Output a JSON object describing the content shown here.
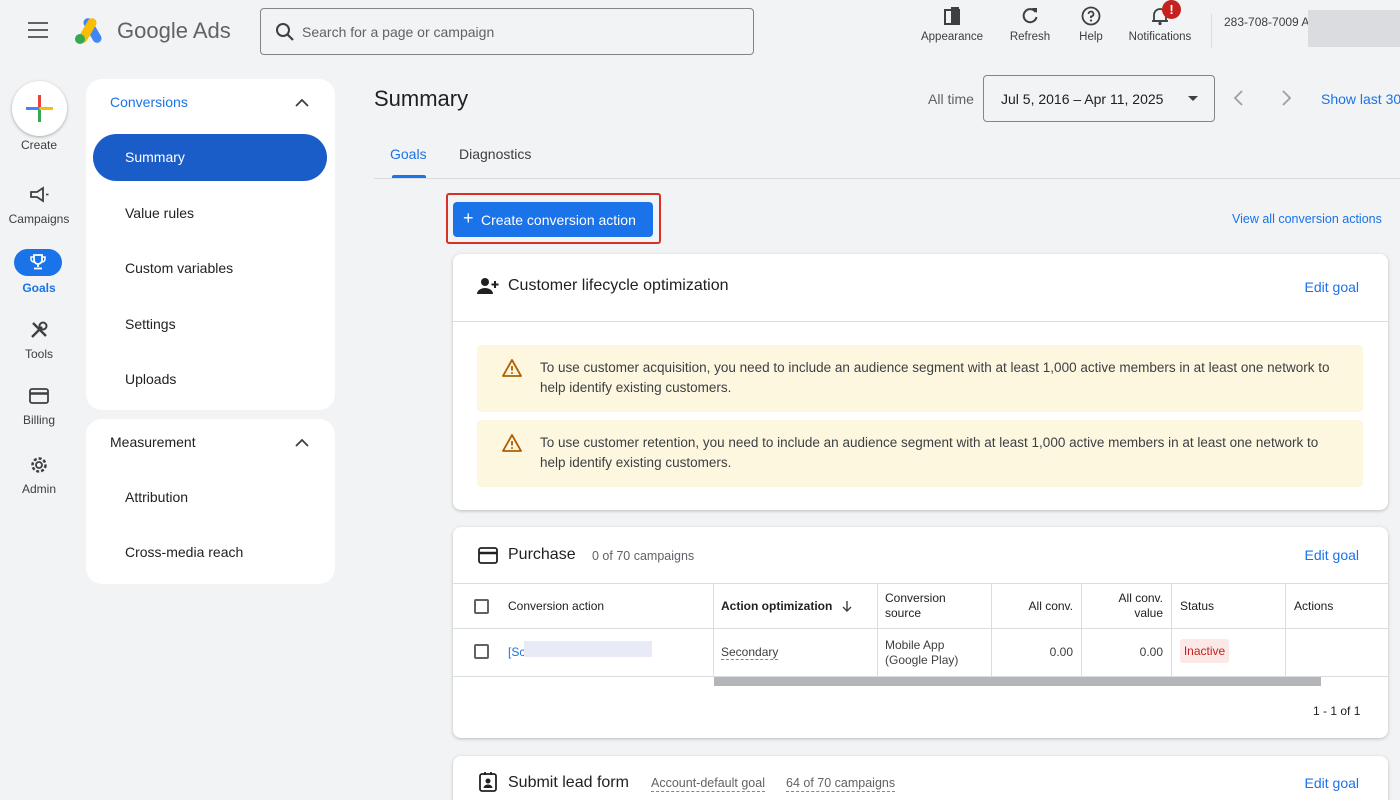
{
  "app": {
    "brand": "Google Ads",
    "logo_colors": [
      "#fbbc04",
      "#4285f4",
      "#34a853"
    ]
  },
  "search": {
    "placeholder": "Search for a page or campaign",
    "value": ""
  },
  "toolbar": {
    "appearance": "Appearance",
    "refresh": "Refresh",
    "help": "Help",
    "notifications": "Notifications",
    "notification_badge": "!",
    "account_id": "283-708-7009 A"
  },
  "rail": {
    "create": "Create",
    "campaigns": "Campaigns",
    "goals": "Goals",
    "tools": "Tools",
    "billing": "Billing",
    "admin": "Admin"
  },
  "sidenav": {
    "conversions_header": "Conversions",
    "conversions_items": [
      "Summary",
      "Value rules",
      "Custom variables",
      "Settings",
      "Uploads"
    ],
    "measurement_header": "Measurement",
    "measurement_items": [
      "Attribution",
      "Cross-media reach"
    ]
  },
  "main": {
    "title": "Summary",
    "all_time": "All time",
    "date_range": "Jul 5, 2016 – Apr 11, 2025",
    "show_last": "Show last 30",
    "tabs": [
      "Goals",
      "Diagnostics"
    ],
    "create_button": "Create conversion action",
    "create_plus": "+",
    "view_all": "View all conversion actions"
  },
  "lifecycle_card": {
    "title": "Customer lifecycle optimization",
    "edit": "Edit goal",
    "warnings": [
      "To use customer acquisition, you need to include an audience segment with at least 1,000 active members in at least one network to help identify existing customers.",
      "To use customer retention, you need to include an audience segment with at least 1,000 active members in at least one network to help identify existing customers."
    ]
  },
  "purchase_card": {
    "title": "Purchase",
    "campaigns": "0 of 70 campaigns",
    "edit": "Edit goal",
    "columns": {
      "action": "Conversion action",
      "optimization": "Action optimization",
      "source_1": "Conversion",
      "source_2": "source",
      "all_conv": "All conv.",
      "value_1": "All conv.",
      "value_2": "value",
      "status": "Status",
      "actions": "Actions"
    },
    "row": {
      "name": "[Sc",
      "optimization": "Secondary",
      "source_1": "Mobile App",
      "source_2": "(Google Play)",
      "all_conv": "0.00",
      "value": "0.00",
      "status": "Inactive"
    },
    "pagination": "1 - 1 of 1"
  },
  "lead_card": {
    "title": "Submit lead form",
    "default": "Account-default goal",
    "campaigns": "64 of 70 campaigns",
    "edit": "Edit goal"
  },
  "colors": {
    "primary": "#1a73e8",
    "active_nav": "#1a5dc9",
    "warning_bg": "#fef7e0",
    "inactive_bg": "#fce8e6",
    "inactive_text": "#c5221f",
    "highlight": "#d93025"
  }
}
